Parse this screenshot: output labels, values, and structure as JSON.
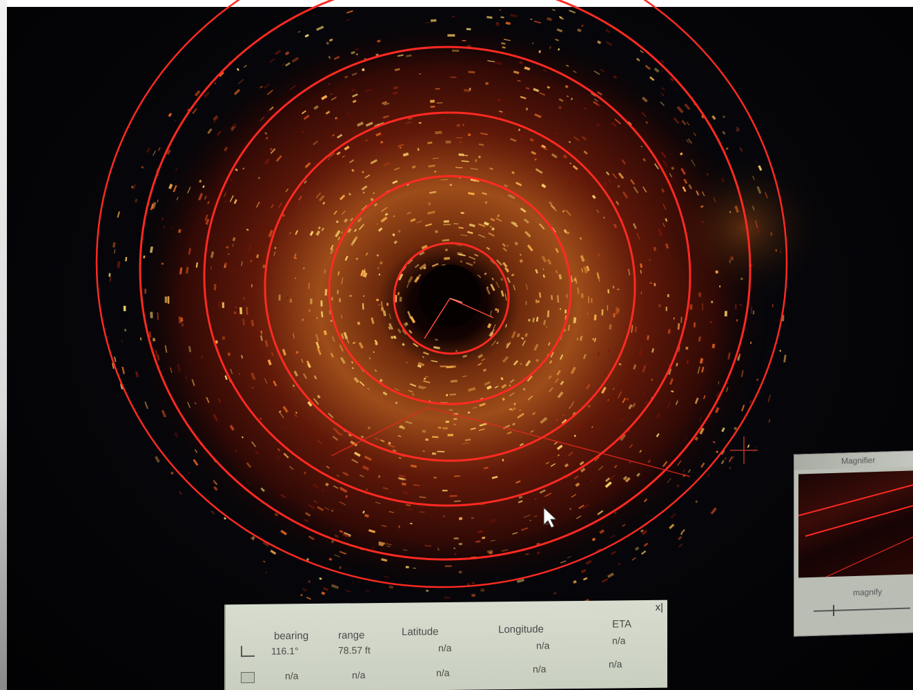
{
  "colors": {
    "ring": "#ff2a22",
    "echo_hot": "#ffd86b",
    "echo_warm": "#e0661e",
    "echo_dark": "#7a1608",
    "panel_bg": "#d7dccf"
  },
  "data_panel": {
    "close_label": "x|",
    "columns": {
      "bearing": "bearing",
      "range": "range",
      "latitude": "Latitude",
      "longitude": "Longitude",
      "eta": "ETA"
    },
    "rows": [
      {
        "icon": "target-cursor-icon",
        "bearing": "116.1°",
        "range": "78.57 ft",
        "latitude": "n/a",
        "longitude": "n/a",
        "eta": "n/a"
      },
      {
        "icon": "waypoint-icon",
        "bearing": "n/a",
        "range": "n/a",
        "latitude": "n/a",
        "longitude": "n/a",
        "eta": "n/a"
      }
    ]
  },
  "magnifier": {
    "title": "Magnifier",
    "zoom_label": "magnify",
    "zoom_level": 0.2
  },
  "icons": {
    "mouse_pointer": "arrow-cursor-icon",
    "crosshair": "crosshair-icon"
  }
}
